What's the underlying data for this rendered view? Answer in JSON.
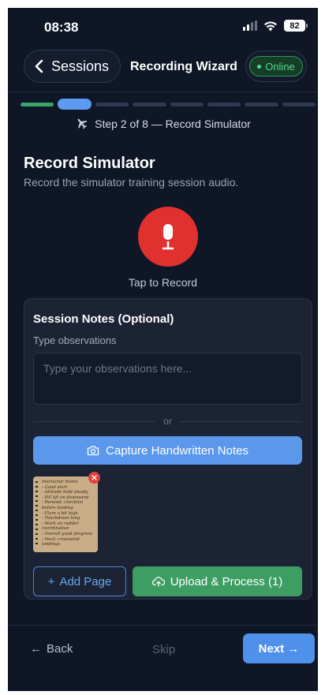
{
  "status_bar": {
    "time": "08:38",
    "battery": "82"
  },
  "header": {
    "back_label": "Sessions",
    "title": "Recording Wizard",
    "status_badge": "Online"
  },
  "progress": {
    "current_step": 2,
    "total_steps": 8,
    "step_text": "Step 2 of 8 — Record Simulator"
  },
  "page": {
    "title": "Record Simulator",
    "subtitle": "Record the simulator training session audio."
  },
  "recorder": {
    "tap_label": "Tap to Record"
  },
  "notes": {
    "title": "Session Notes (Optional)",
    "input_label": "Type observations",
    "input_placeholder": "Type your observations here...",
    "input_value": "",
    "divider_text": "or",
    "capture_label": "Capture Handwritten Notes",
    "thumbnail_text": [
      "Instructor Notes",
      "- Good start",
      "- Altitude hold steady",
      "- HS lift on downwind",
      "- Remind: checklist",
      "  before landing",
      "- Flare a bit high",
      "- Touchdown long",
      "- Work on rudder",
      "  coordination",
      "- Overall good progress",
      "- Next: crosswind",
      "  landings"
    ],
    "add_page_label": "Add Page",
    "upload_label": "Upload & Process (1)"
  },
  "footer": {
    "back_label": "Back",
    "skip_label": "Skip",
    "next_label": "Next →"
  },
  "colors": {
    "background": "#0f1626",
    "accent_blue": "#5b98ec",
    "record_red": "#e0312f",
    "success_green": "#3d9d63",
    "online_green": "#58d68d"
  },
  "icons": {
    "back": "chevron-left-icon",
    "step": "airplane-icon",
    "record": "microphone-icon",
    "capture": "camera-icon",
    "remove": "close-icon",
    "add": "plus-icon",
    "upload": "cloud-upload-icon"
  }
}
